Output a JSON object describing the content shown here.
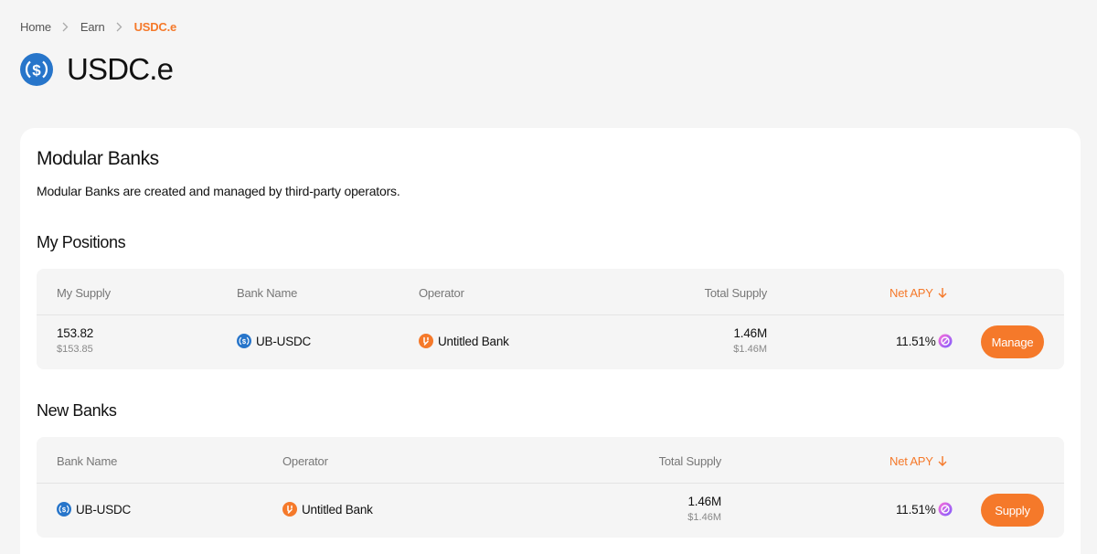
{
  "breadcrumb": {
    "home": "Home",
    "earn": "Earn",
    "current": "USDC.e"
  },
  "page": {
    "title": "USDC.e"
  },
  "card": {
    "title": "Modular Banks",
    "description": "Modular Banks are created and managed by third-party operators."
  },
  "positions": {
    "title": "My Positions",
    "headers": {
      "my_supply": "My Supply",
      "bank_name": "Bank Name",
      "operator": "Operator",
      "total_supply": "Total Supply",
      "net_apy": "Net APY"
    },
    "rows": [
      {
        "my_supply": "153.82",
        "my_supply_usd": "$153.85",
        "bank_name": "UB-USDC",
        "operator": "Untitled Bank",
        "total_supply": "1.46M",
        "total_supply_usd": "$1.46M",
        "net_apy": "11.51%",
        "action": "Manage"
      }
    ]
  },
  "new_banks": {
    "title": "New Banks",
    "headers": {
      "bank_name": "Bank Name",
      "operator": "Operator",
      "total_supply": "Total Supply",
      "net_apy": "Net APY"
    },
    "rows": [
      {
        "bank_name": "UB-USDC",
        "operator": "Untitled Bank",
        "total_supply": "1.46M",
        "total_supply_usd": "$1.46M",
        "net_apy": "11.51%",
        "action": "Supply"
      }
    ]
  },
  "colors": {
    "accent": "#f5792a",
    "usdc_blue": "#2775ca",
    "page_bg": "#f5f5f5"
  },
  "icons": [
    "chevron-right-icon",
    "usdc-icon",
    "untitled-bank-icon",
    "sort-down-icon",
    "rewards-icon"
  ]
}
